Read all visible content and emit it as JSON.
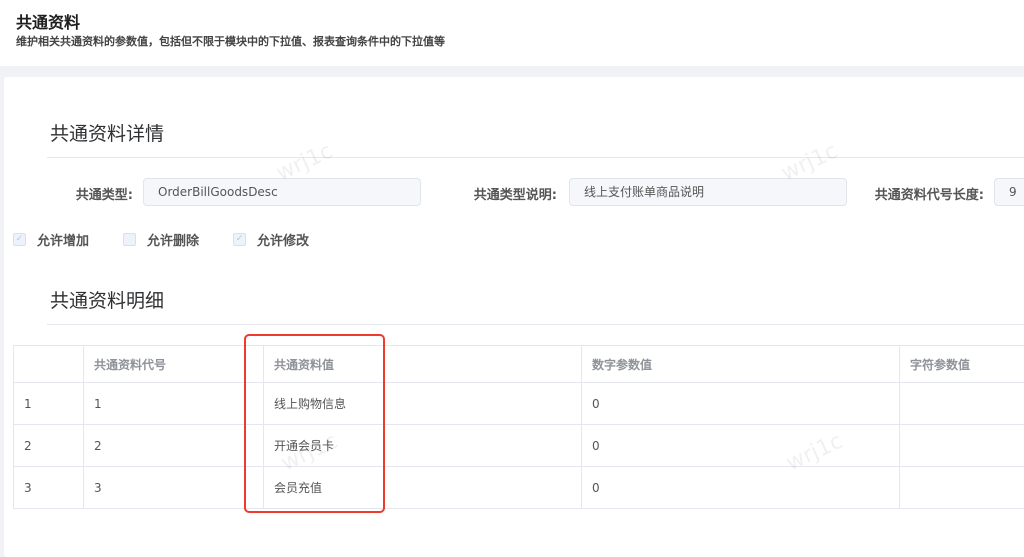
{
  "header": {
    "title": "共通资料",
    "subtitle": "维护相关共通资料的参数值，包括但不限于模块中的下拉值、报表查询条件中的下拉值等"
  },
  "detail": {
    "title": "共通资料详情",
    "fields": [
      {
        "label": "共通类型:",
        "value": "OrderBillGoodsDesc"
      },
      {
        "label": "共通类型说明:",
        "value": "线上支付账单商品说明"
      },
      {
        "label": "共通资料代号长度:",
        "value": "9"
      }
    ],
    "checkboxes": [
      {
        "label": "允许增加",
        "checked": true
      },
      {
        "label": "允许删除",
        "checked": false
      },
      {
        "label": "允许修改",
        "checked": true
      }
    ]
  },
  "list": {
    "title": "共通资料明细",
    "columns": [
      "",
      "共通资料代号",
      "共通资料值",
      "数字参数值",
      "字符参数值"
    ],
    "rows": [
      [
        "1",
        "1",
        "线上购物信息",
        "0",
        ""
      ],
      [
        "2",
        "2",
        "开通会员卡",
        "0",
        ""
      ],
      [
        "3",
        "3",
        "会员充值",
        "0",
        ""
      ]
    ]
  },
  "watermark": "wrj1c"
}
